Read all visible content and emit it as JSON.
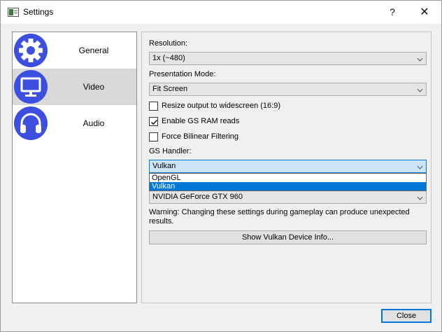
{
  "window": {
    "title": "Settings",
    "help_label": "?",
    "close_label": "✕"
  },
  "sidebar": {
    "items": [
      {
        "label": "General",
        "icon": "gear-icon",
        "selected": false
      },
      {
        "label": "Video",
        "icon": "monitor-icon",
        "selected": true
      },
      {
        "label": "Audio",
        "icon": "headphones-icon",
        "selected": false
      }
    ]
  },
  "video": {
    "resolution_label": "Resolution:",
    "resolution_value": "1x (~480)",
    "presentation_label": "Presentation Mode:",
    "presentation_value": "Fit Screen",
    "checkboxes": [
      {
        "label": "Resize output to widescreen (16:9)",
        "checked": false
      },
      {
        "label": "Enable GS RAM reads",
        "checked": true
      },
      {
        "label": "Force Bilinear Filtering",
        "checked": false
      }
    ],
    "gs_handler_label": "GS Handler:",
    "gs_handler_value": "Vulkan",
    "gs_handler_options": [
      "OpenGL",
      "Vulkan"
    ],
    "device_value": "NVIDIA GeForce GTX 960",
    "warning": "Warning: Changing these settings during gameplay can produce unexpected results.",
    "device_info_button": "Show Vulkan Device Info..."
  },
  "footer": {
    "close_button": "Close"
  },
  "colors": {
    "accent": "#0078d7",
    "sidebar_icon": "#3c4fdf",
    "selected_item": "#d9d9d9"
  }
}
